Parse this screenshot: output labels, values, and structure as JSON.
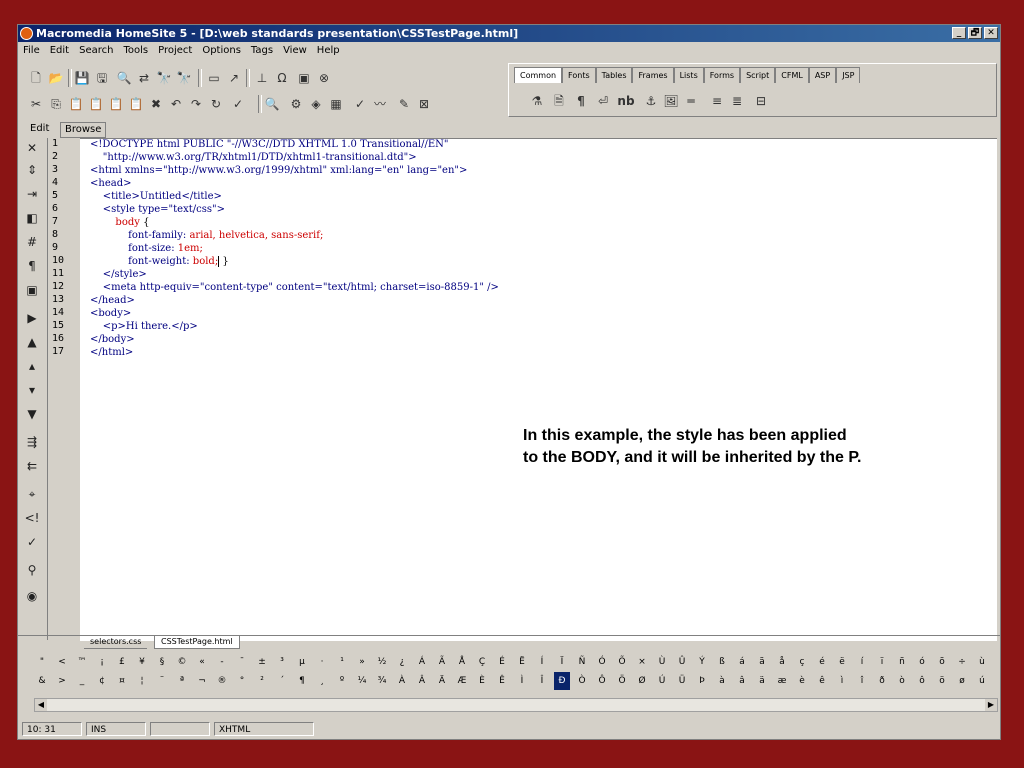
{
  "window": {
    "title": "Macromedia HomeSite 5 - [D:\\web standards presentation\\CSSTestPage.html]",
    "min_label": "_",
    "max_label": "🗗",
    "close_label": "✕"
  },
  "menu": [
    "File",
    "Edit",
    "Search",
    "Tools",
    "Project",
    "Options",
    "Tags",
    "View",
    "Help"
  ],
  "quickbar": {
    "tabs": [
      "Common",
      "Fonts",
      "Tables",
      "Frames",
      "Lists",
      "Forms",
      "Script",
      "CFML",
      "ASP",
      "JSP"
    ],
    "active_tab": "Common",
    "nb_label": "nb",
    "para_label": "¶"
  },
  "view_tabs": {
    "edit": "Edit",
    "browse": "Browse"
  },
  "line_numbers": [
    "1",
    "2",
    "3",
    "4",
    "5",
    "6",
    "7",
    "8",
    "9",
    "10",
    "11",
    "12",
    "13",
    "14",
    "15",
    "16",
    "17"
  ],
  "code": {
    "l1": "<!DOCTYPE html PUBLIC \"-//W3C//DTD XHTML 1.0 Transitional//EN\"",
    "l2": "    \"http://www.w3.org/TR/xhtml1/DTD/xhtml1-transitional.dtd\">",
    "l3": "<html xmlns=\"http://www.w3.org/1999/xhtml\" xml:lang=\"en\" lang=\"en\">",
    "l4": "<head>",
    "l5": "    <title>Untitled</title>",
    "l6": "    <style type=\"text/css\">",
    "l7a": "        body ",
    "l7b": "{",
    "l8a": "            font-family: ",
    "l8b": "arial, helvetica, sans-serif;",
    "l9a": "            font-size: ",
    "l9b": "1em;",
    "l10a": "            font-weight: ",
    "l10b": "bold;",
    "l10c": " }",
    "l11": "    </style>",
    "l12": "    <meta http-equiv=\"content-type\" content=\"text/html; charset=iso-8859-1\" />",
    "l13": "</head>",
    "l14": "<body>",
    "l15": "    <p>Hi there.</p>",
    "l16": "</body>",
    "l17": "</html>"
  },
  "note": "In this example, the style has been applied to the BODY, and it will be inherited by the P.",
  "doc_tabs": [
    "selectors.css",
    "CSSTestPage.html"
  ],
  "charbar": {
    "row1": [
      "\"",
      "<",
      "™",
      "¡",
      "£",
      "¥",
      "§",
      "©",
      "«",
      "-",
      "¯",
      "±",
      "³",
      "µ",
      "·",
      "¹",
      "»",
      "½",
      "¿",
      "Á",
      "Ã",
      "Å",
      "Ç",
      "É",
      "Ë",
      "Í",
      "Ï",
      "Ñ",
      "Ó",
      "Õ",
      "×",
      "Ù",
      "Û",
      "Ý",
      "ß",
      "á",
      "ã",
      "å",
      "ç",
      "é",
      "ë",
      "í",
      "ï",
      "ñ",
      "ó",
      "õ",
      "÷",
      "ù"
    ],
    "row2": [
      "&",
      ">",
      "_",
      "¢",
      "¤",
      "¦",
      "¨",
      "ª",
      "¬",
      "®",
      "°",
      "²",
      "´",
      "¶",
      "¸",
      "º",
      "¼",
      "¾",
      "À",
      "Â",
      "Ä",
      "Æ",
      "È",
      "Ê",
      "Ì",
      "Î",
      "Ð",
      "Ò",
      "Ô",
      "Ö",
      "Ø",
      "Ú",
      "Ü",
      "Þ",
      "à",
      "â",
      "ä",
      "æ",
      "è",
      "ê",
      "ì",
      "î",
      "ð",
      "ò",
      "ô",
      "ö",
      "ø",
      "ú"
    ],
    "selected_row2_index": 26
  },
  "status": {
    "position": "10: 31",
    "mode": "INS",
    "doctype": "XHTML"
  }
}
